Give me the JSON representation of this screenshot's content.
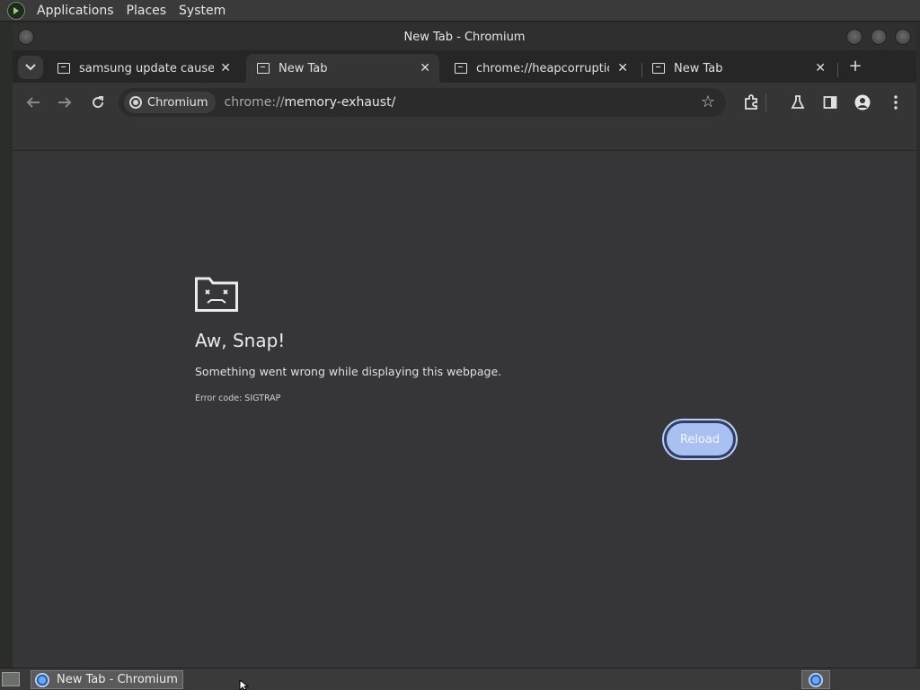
{
  "system_panel": {
    "menus": [
      "Applications",
      "Places",
      "System"
    ]
  },
  "window": {
    "title": "New Tab - Chromium"
  },
  "tabs": [
    {
      "title": "samsung update cause gre",
      "active": false
    },
    {
      "title": "New Tab",
      "active": true
    },
    {
      "title": "chrome://heapcorruption",
      "active": false
    },
    {
      "title": "New Tab",
      "active": false
    }
  ],
  "toolbar": {
    "site_chip": "Chromium",
    "url_prefix": "chrome://",
    "url_host": "memory-exhaust/"
  },
  "error_page": {
    "title": "Aw, Snap!",
    "message": "Something went wrong while displaying this webpage.",
    "code": "Error code: SIGTRAP",
    "reload_label": "Reload"
  },
  "taskbar": {
    "task_label": "New Tab - Chromium"
  },
  "colors": {
    "reload_fill": "#a9c1f2",
    "page_bg": "#363638"
  }
}
